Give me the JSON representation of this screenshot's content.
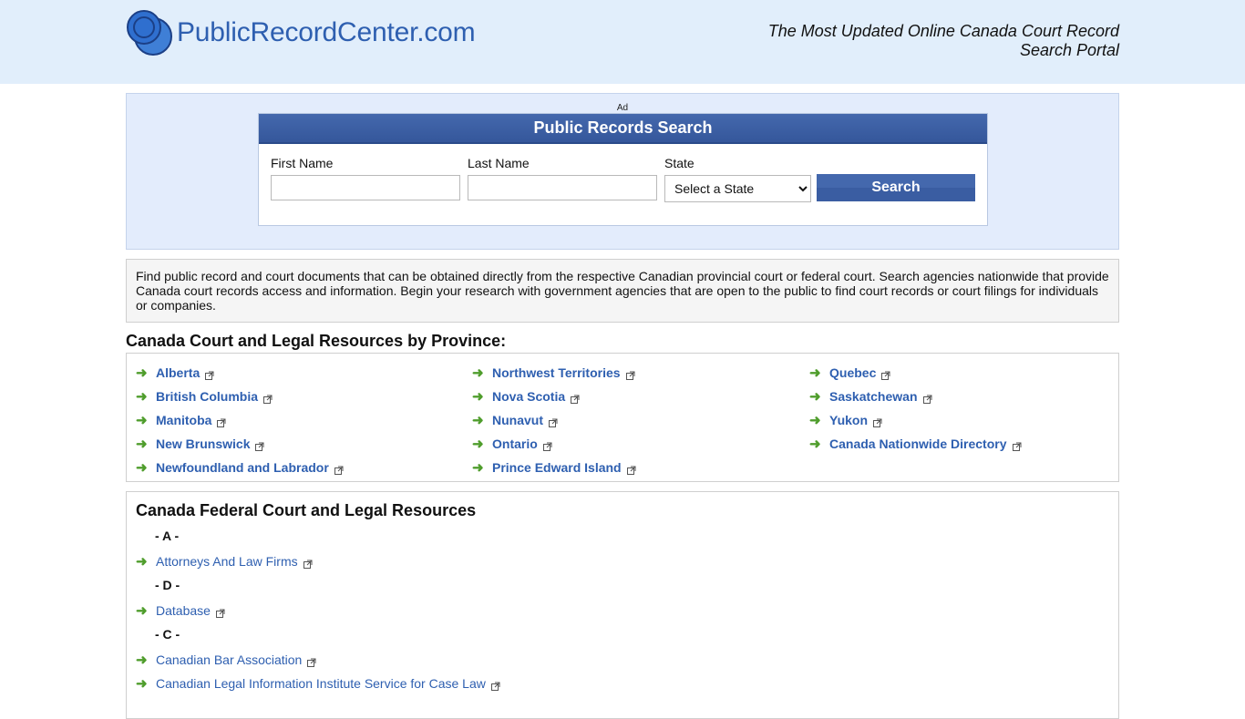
{
  "header": {
    "logo_text": "PublicRecordCenter.com",
    "tagline": "The Most Updated Online Canada Court Record Search Portal"
  },
  "search": {
    "ad_label": "Ad",
    "title": "Public Records Search",
    "first_name_label": "First Name",
    "last_name_label": "Last Name",
    "state_label": "State",
    "state_selected": "Select a State",
    "button_label": "Search"
  },
  "intro": {
    "text": "Find public record and court documents that can be obtained directly from the respective Canadian provincial court or federal court. Search agencies nationwide that provide Canada court records access and information. Begin your research with government agencies that are open to the public to find court records or court filings for individuals or companies."
  },
  "provinces": {
    "heading": "Canada Court and Legal Resources by Province:",
    "columns": [
      [
        "Alberta",
        "British Columbia",
        "Manitoba",
        "New Brunswick",
        "Newfoundland and Labrador"
      ],
      [
        "Northwest Territories",
        "Nova Scotia",
        "Nunavut",
        "Ontario",
        "Prince Edward Island"
      ],
      [
        "Quebec",
        "Saskatchewan",
        "Yukon",
        "Canada Nationwide Directory"
      ]
    ]
  },
  "federal": {
    "title": "Canada Federal Court and Legal Resources",
    "groups": [
      {
        "letter": "- A -",
        "links": [
          "Attorneys And Law Firms"
        ]
      },
      {
        "letter": "- D -",
        "links": [
          "Database"
        ]
      },
      {
        "letter": "- C -",
        "links": [
          "Canadian Bar Association",
          "Canadian Legal Information Institute Service for Case Law"
        ]
      }
    ]
  },
  "colors": {
    "brand_blue": "#2e5fb0",
    "header_bg": "#e1eefb",
    "arrow_green": "#4f9d2c"
  },
  "icons": {
    "arrow": "right-arrow-icon",
    "external": "external-link-icon",
    "logo": "logo-circles-icon"
  }
}
